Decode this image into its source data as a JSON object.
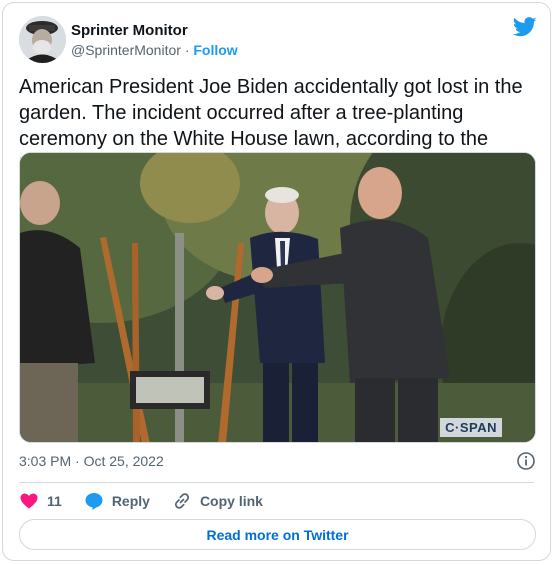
{
  "author": {
    "name": "Sprinter Monitor",
    "handle": "@SprinterMonitor",
    "separator": "·",
    "follow_label": "Follow",
    "avatar_icon": "avatar-photo"
  },
  "tweet": {
    "text": "American President Joe Biden accidentally got lost in the garden. The incident occurred after a tree-planting ceremony on the White House lawn, according to the Daily Mail.",
    "media_watermark": "C·SPAN",
    "timestamp": "3:03 PM · Oct 25, 2022"
  },
  "actions": {
    "like_count": "11",
    "reply_label": "Reply",
    "copy_link_label": "Copy link"
  },
  "footer": {
    "read_more_label": "Read more on Twitter"
  },
  "colors": {
    "twitter_blue": "#1d9bf0",
    "like_red": "#f91880",
    "secondary_text": "#536471"
  }
}
